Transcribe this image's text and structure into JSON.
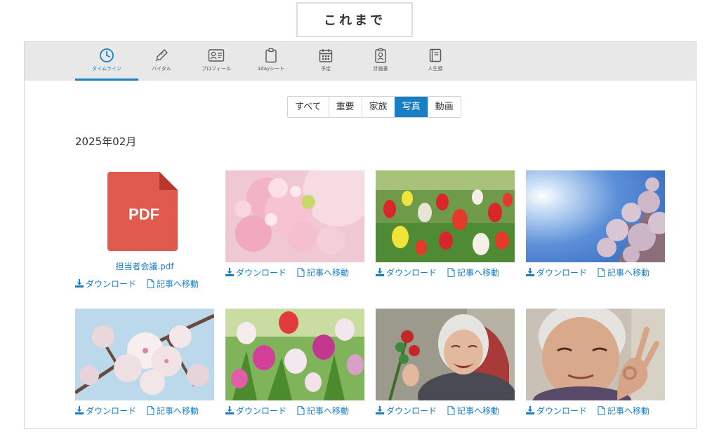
{
  "page": {
    "title": "これまで"
  },
  "tabs": [
    {
      "label": "タイムライン",
      "icon": "clock-icon",
      "active": true
    },
    {
      "label": "バイタル",
      "icon": "thermometer-icon"
    },
    {
      "label": "プロフィール",
      "icon": "profile-card-icon"
    },
    {
      "label": "1dayシート",
      "icon": "clipboard-icon"
    },
    {
      "label": "予定",
      "icon": "calendar-icon"
    },
    {
      "label": "計画書",
      "icon": "id-badge-icon"
    },
    {
      "label": "人生録",
      "icon": "notebook-icon"
    }
  ],
  "filters": [
    {
      "label": "すべて"
    },
    {
      "label": "重要"
    },
    {
      "label": "家族"
    },
    {
      "label": "写真",
      "active": true
    },
    {
      "label": "動画"
    }
  ],
  "month_label": "2025年02月",
  "actions": {
    "download": "ダウンロード",
    "goto": "記事へ移動"
  },
  "items": [
    {
      "type": "pdf",
      "filename": "担当者会議.pdf",
      "badge": "PDF"
    },
    {
      "type": "image",
      "subject": "pink-cherry-blossoms"
    },
    {
      "type": "image",
      "subject": "tulip-field"
    },
    {
      "type": "image",
      "subject": "cherry-tree-blue-sky"
    },
    {
      "type": "image",
      "subject": "white-cherry-blossoms"
    },
    {
      "type": "image",
      "subject": "pink-tulips"
    },
    {
      "type": "image",
      "subject": "smiling-elderly-woman-flowers"
    },
    {
      "type": "image",
      "subject": "elderly-woman-ok-sign"
    }
  ],
  "colors": {
    "accent": "#1a7ec2",
    "pdf": "#e05a4e",
    "tabbar": "#e8e8e8"
  }
}
